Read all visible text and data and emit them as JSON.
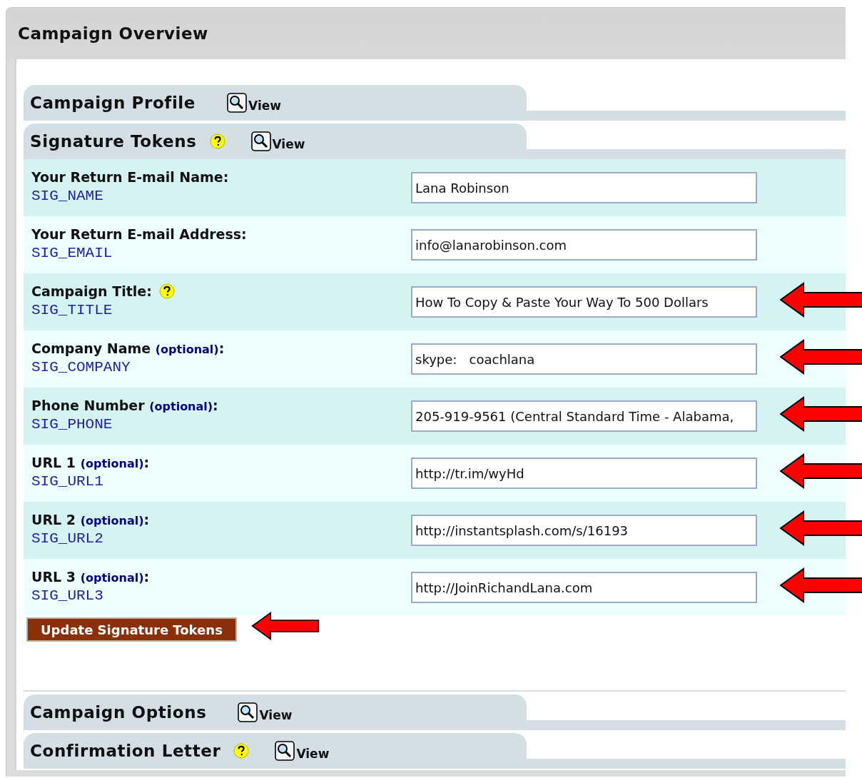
{
  "page": {
    "title": "Campaign Overview"
  },
  "sections": [
    {
      "title": "Campaign Profile",
      "help": false,
      "view_label": "View"
    },
    {
      "title": "Signature Tokens",
      "help": true,
      "view_label": "View",
      "fields": [
        {
          "label": "Your Return E-mail Name:",
          "token": "SIG_NAME",
          "value": "Lana Robinson",
          "help": false,
          "highlighted": false
        },
        {
          "label": "Your Return E-mail Address:",
          "token": "SIG_EMAIL",
          "value": "info@lanarobinson.com",
          "help": false,
          "highlighted": false
        },
        {
          "label": "Campaign Title:",
          "token": "SIG_TITLE",
          "value": "How To Copy & Paste Your Way To 500 Dollars",
          "help": true,
          "highlighted": true
        },
        {
          "label": "Company Name **(optional)**:",
          "token": "SIG_COMPANY",
          "value": "skype:   coachlana",
          "help": false,
          "highlighted": true
        },
        {
          "label": "Phone Number **(optional)**:",
          "token": "SIG_PHONE",
          "value": "205-919-9561 (Central Standard Time - Alabama,",
          "help": false,
          "highlighted": true
        },
        {
          "label": "URL 1 **(optional)**:",
          "token": "SIG_URL1",
          "value": "http://tr.im/wyHd",
          "help": false,
          "highlighted": true
        },
        {
          "label": "URL 2 **(optional)**:",
          "token": "SIG_URL2",
          "value": "http://instantsplash.com/s/16193",
          "help": false,
          "highlighted": true
        },
        {
          "label": "URL 3 **(optional)**:",
          "token": "SIG_URL3",
          "value": "http://JoinRichandLana.com",
          "help": false,
          "highlighted": true
        }
      ],
      "button": {
        "label": "Update Signature Tokens",
        "highlighted": true
      }
    },
    {
      "title": "Campaign Options",
      "help": false,
      "view_label": "View"
    },
    {
      "title": "Confirmation Letter",
      "help": true,
      "view_label": "View"
    }
  ]
}
